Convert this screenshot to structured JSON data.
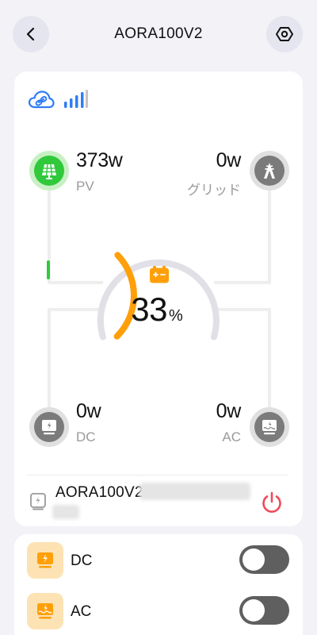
{
  "header": {
    "title": "AORA100V2"
  },
  "status": {
    "cloud_icon": "cloud-link-icon",
    "signal_icon": "signal-bars-icon",
    "signal_color": "#2f7df6"
  },
  "flow": {
    "pv": {
      "value": "373w",
      "label": "PV",
      "icon": "solar-panel-icon",
      "color": "#30c93c"
    },
    "grid": {
      "value": "0w",
      "label": "グリッド",
      "icon": "grid-tower-icon"
    },
    "dc": {
      "value": "0w",
      "label": "DC",
      "icon": "dc-output-icon"
    },
    "ac": {
      "value": "0w",
      "label": "AC",
      "icon": "ac-output-icon"
    }
  },
  "battery": {
    "percent": "33",
    "unit": "%",
    "level": 0.33,
    "arc_color": "#ff9f0a",
    "icon": "battery-icon"
  },
  "device": {
    "name": "AORA100V2",
    "icon": "device-icon",
    "power_icon": "power-icon",
    "power_color": "#ef4b5b"
  },
  "outputs": [
    {
      "label": "DC",
      "icon": "dc-output-icon",
      "enabled": false
    },
    {
      "label": "AC",
      "icon": "ac-output-icon",
      "enabled": false
    }
  ]
}
